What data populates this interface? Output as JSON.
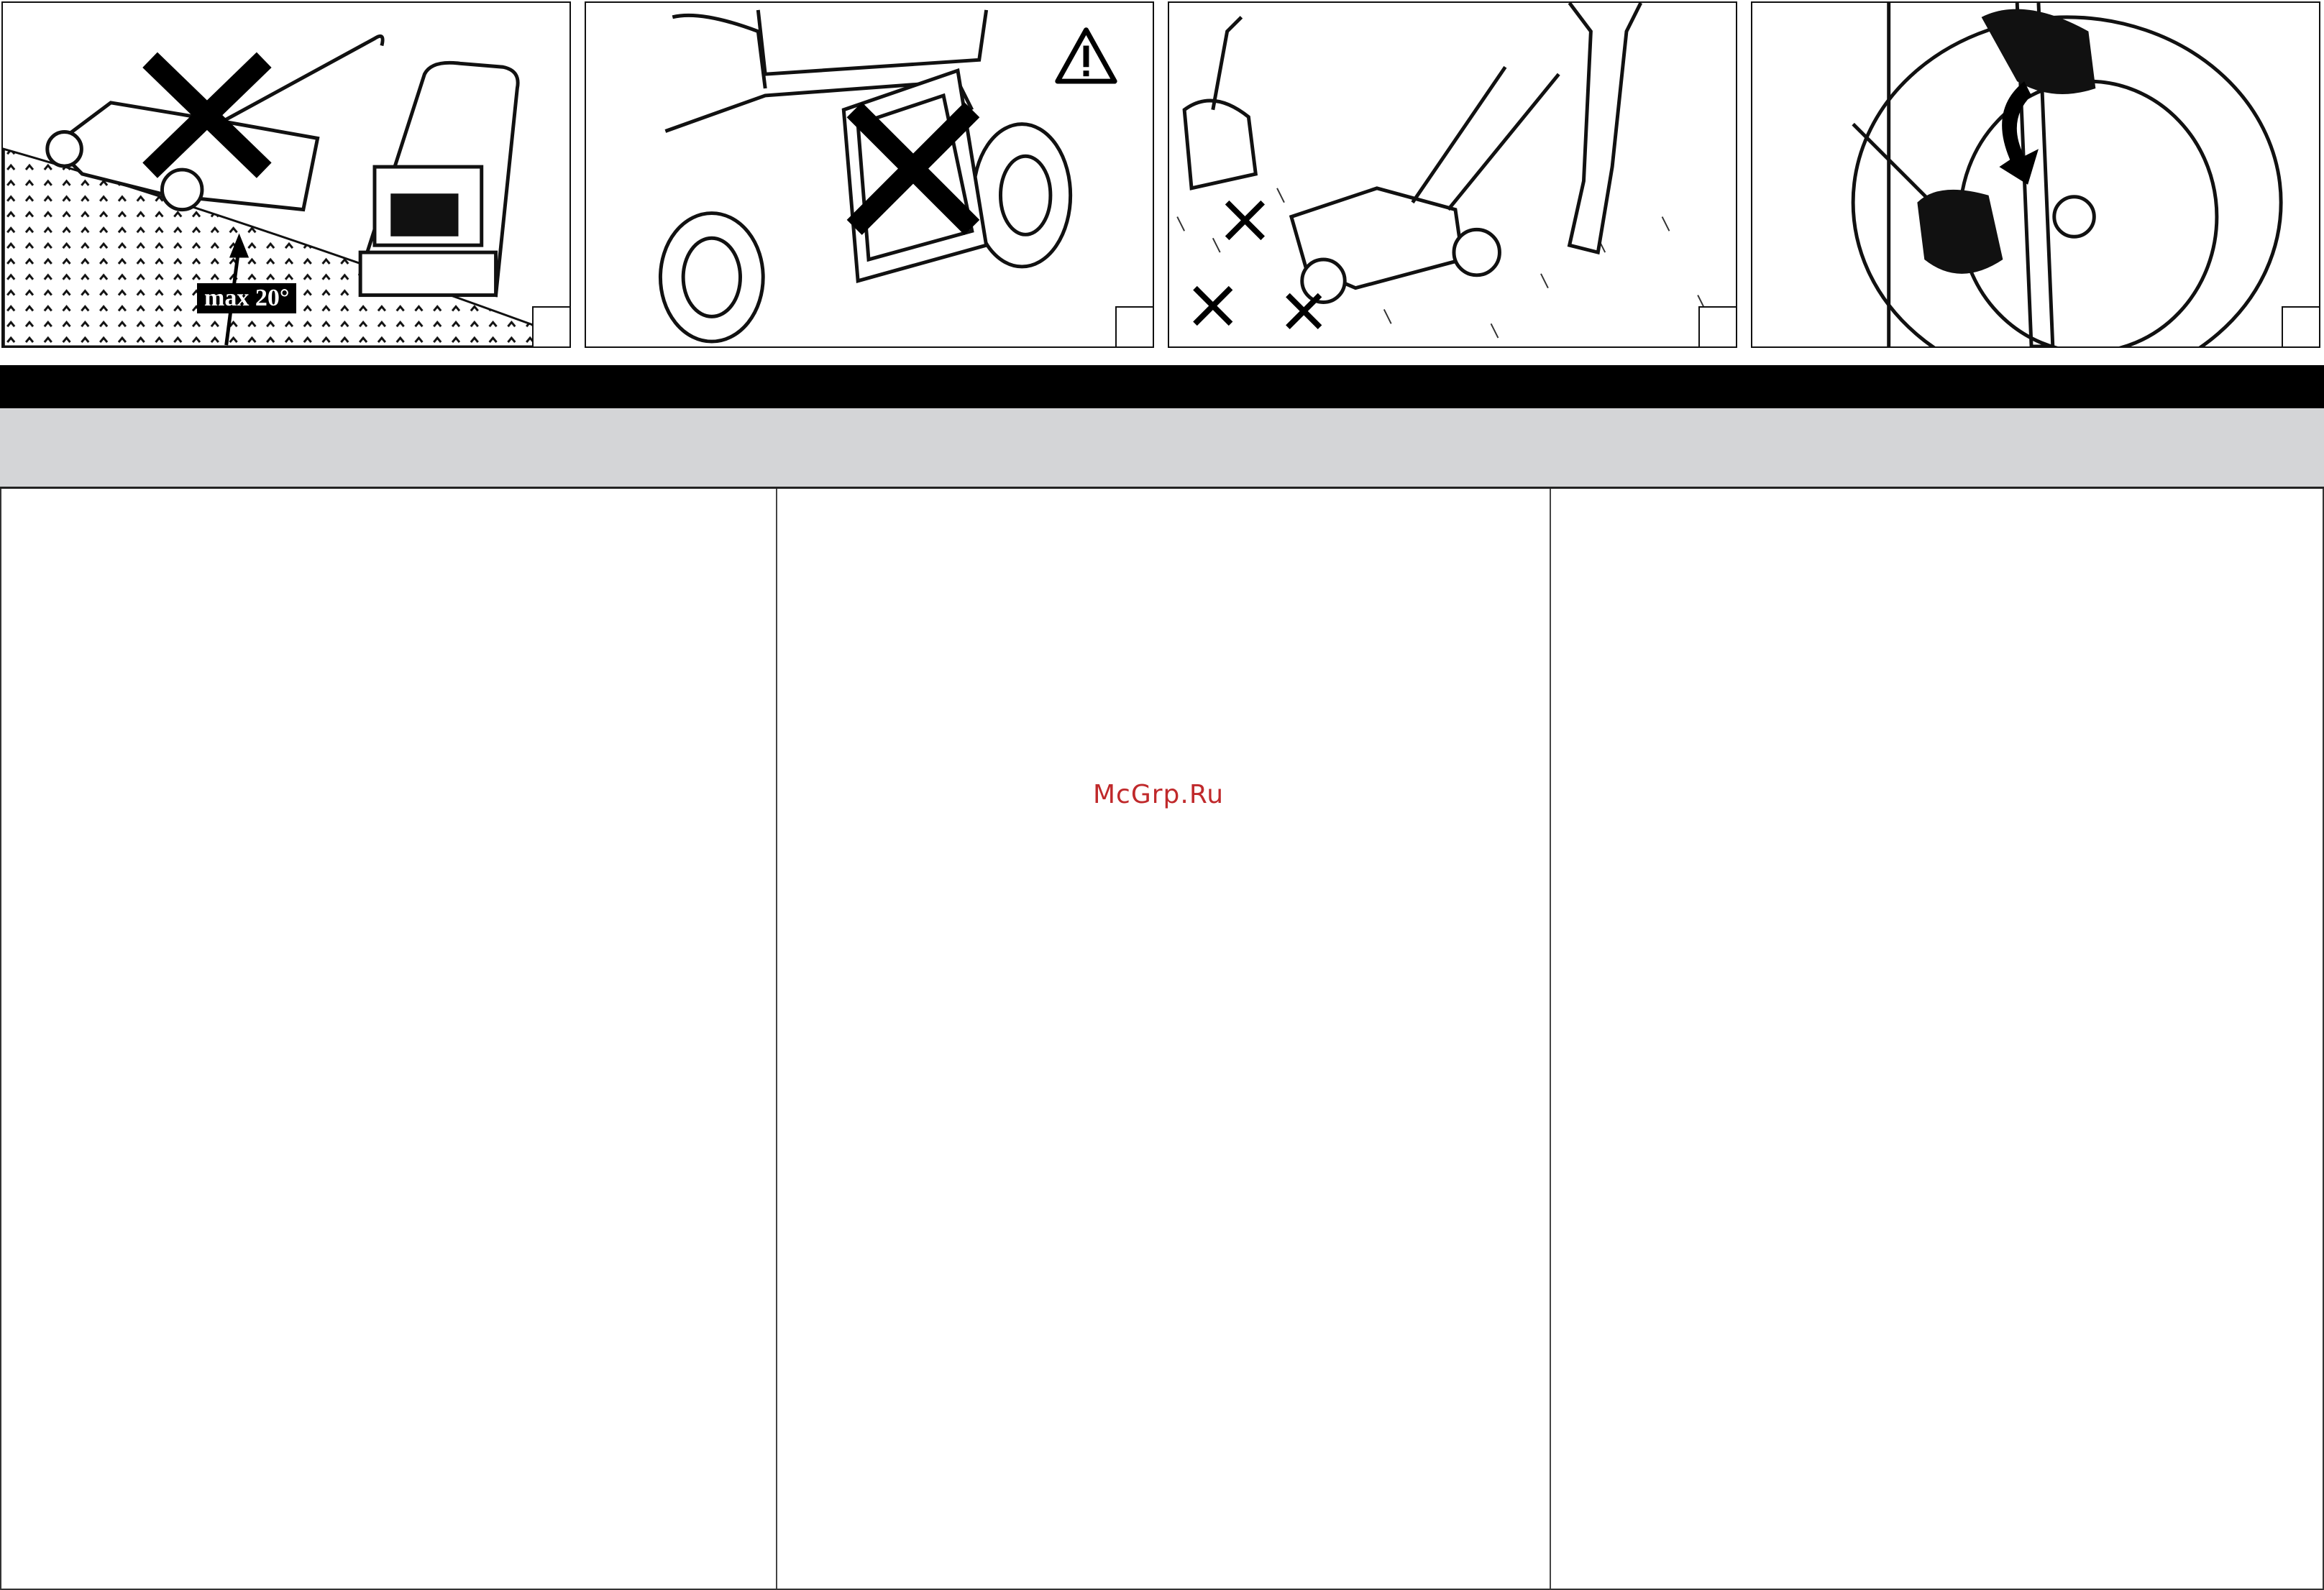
{
  "illustrations": [
    {
      "id": "slope-warning",
      "label": "max 20°"
    },
    {
      "id": "grass-bag-warning"
    },
    {
      "id": "obstacles-warning"
    },
    {
      "id": "blade-change"
    }
  ],
  "watermark": "McGrp.Ru",
  "colors": {
    "band_dark": "#000000",
    "band_grey": "#d4d5d7",
    "watermark": "#c0292b"
  },
  "icons": [
    "cross-out-icon",
    "warning-triangle-icon",
    "rotate-arrow-icon"
  ]
}
